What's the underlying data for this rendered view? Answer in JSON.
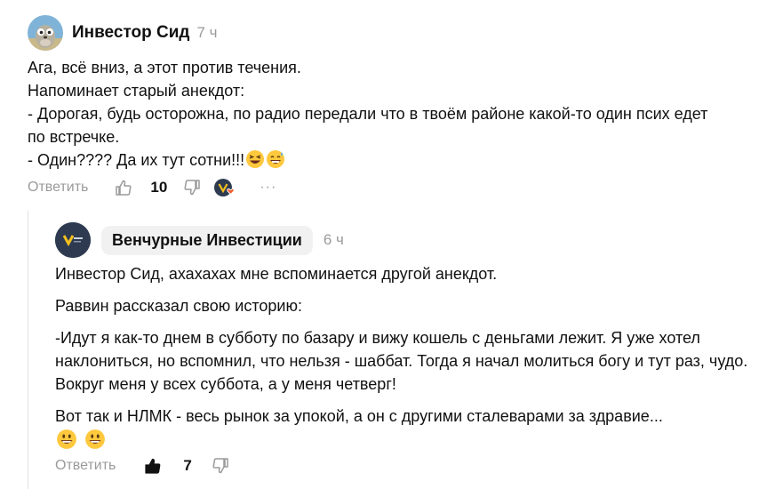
{
  "comment": {
    "author": "Инвестор Сид",
    "time": "7 ч",
    "lines": [
      "Ага, всё вниз, а этот против течения.",
      "Напоминает старый анекдот:",
      "- Дорогая, будь осторожна, по радио передали что в твоём районе какой-то один псих едет по встречке.",
      "- Один???? Да их тут сотни!!!"
    ],
    "reply_label": "Ответить",
    "likes": "10",
    "more_glyph": "···"
  },
  "reply": {
    "author": "Венчурные Инвестиции",
    "time": "6 ч",
    "paragraphs": [
      "Инвестор Сид, ахахахах мне вспоминается другой анекдот.",
      "Раввин рассказал свою историю:",
      "-Идут я как-то днем в субботу по базару и вижу кошель с деньгами лежит. Я уже хотел наклониться, но вспомнил, что нельзя - шаббат. Тогда я начал молиться богу и тут раз, чудо. Вокруг меня у всех суббота, а у меня четверг!",
      "Вот так и НЛМК - весь рынок за упокой, а он с другими сталеварами за здравие..."
    ],
    "reply_label": "Ответить",
    "likes": "7"
  },
  "colors": {
    "muted": "#9a9a9a",
    "thread_line": "#e3e3e3",
    "chip_bg": "#f1f1f1",
    "emoji_yellow": "#ffc83d",
    "heart": "#f05a28"
  },
  "icons": [
    "avatar-sid",
    "avatar-venture",
    "laughing-emoji",
    "grinning-emoji",
    "thumbs-up-icon",
    "thumbs-down-icon",
    "reaction-avatar-icon",
    "more-icon"
  ]
}
